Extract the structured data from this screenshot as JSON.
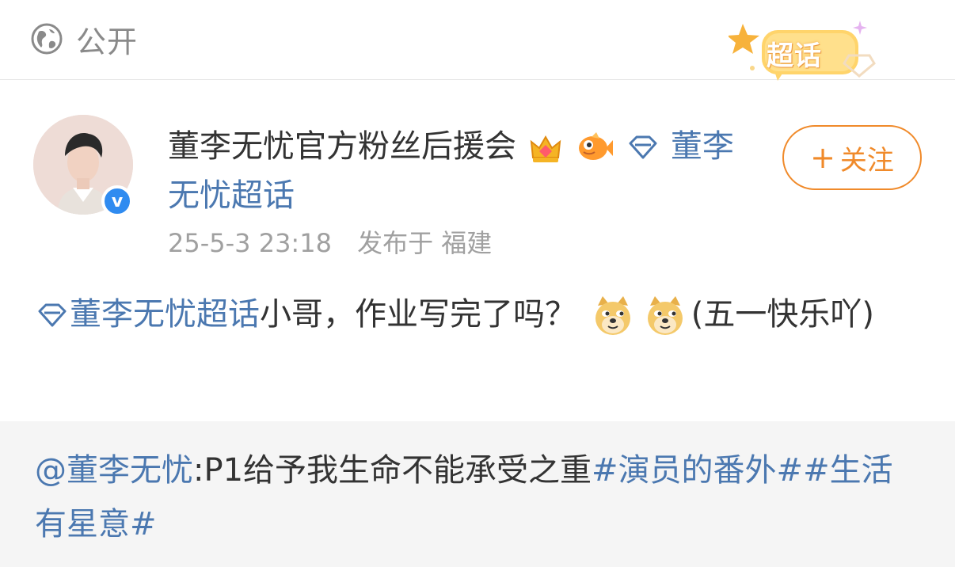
{
  "header": {
    "visibility_label": "公开",
    "badge_label": "超话"
  },
  "author": {
    "name": "董李无忧官方粉丝后援会",
    "topic_link": "董李无忧超话",
    "verified_mark": "v",
    "timestamp": "25-5-3 23:18",
    "location": "发布于 福建"
  },
  "follow_button": {
    "plus": "+",
    "label": "关注"
  },
  "post": {
    "topic_link": "董李无忧超话",
    "text_before_emoji": "小哥，作业写完了吗？",
    "text_after_emoji": "(五一快乐吖)"
  },
  "repost": {
    "mention": "@董李无忧",
    "text": ":P1给予我生命不能承受之重",
    "hashtag_1": "#演员的番外#",
    "hashtag_2": "#生活有星意#"
  },
  "colors": {
    "link": "#4b78b0",
    "follow_accent": "#f08a2a",
    "verified": "#2f8bf0",
    "repost_bg": "#f5f5f5"
  }
}
